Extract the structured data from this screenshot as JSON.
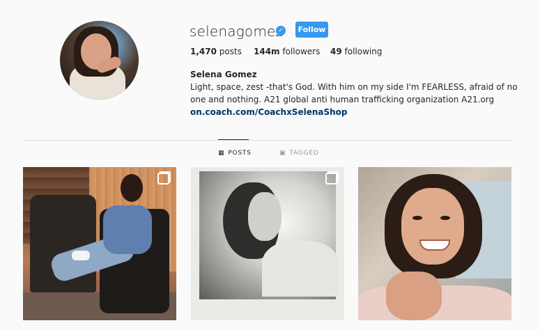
{
  "profile": {
    "username": "selenagomez",
    "verified": true,
    "follow_label": "Follow",
    "stats": {
      "posts_count": "1,470",
      "posts_label": "posts",
      "followers_count": "144m",
      "followers_label": "followers",
      "following_count": "49",
      "following_label": "following"
    },
    "full_name": "Selena Gomez",
    "bio_line": "Light, space, zest -that's God. With him on my side I'm FEARLESS, afraid of no one and nothing. A21 global anti human trafficking organization A21.org",
    "link": "on.coach.com/CoachxSelenaShop"
  },
  "tabs": [
    {
      "label": "POSTS",
      "icon": "grid-icon",
      "active": true
    },
    {
      "label": "TAGGED",
      "icon": "tagged-icon",
      "active": false
    }
  ],
  "posts": [
    {
      "description_icon": "multiple-photos-icon",
      "multi": true
    },
    {
      "description_icon": "multiple-photos-icon",
      "multi": true
    },
    {
      "description_icon": "none",
      "multi": false
    }
  ],
  "colors": {
    "accent": "#3897f0",
    "link": "#003569",
    "text": "#262626",
    "muted": "#999999",
    "background": "#fafafa"
  }
}
